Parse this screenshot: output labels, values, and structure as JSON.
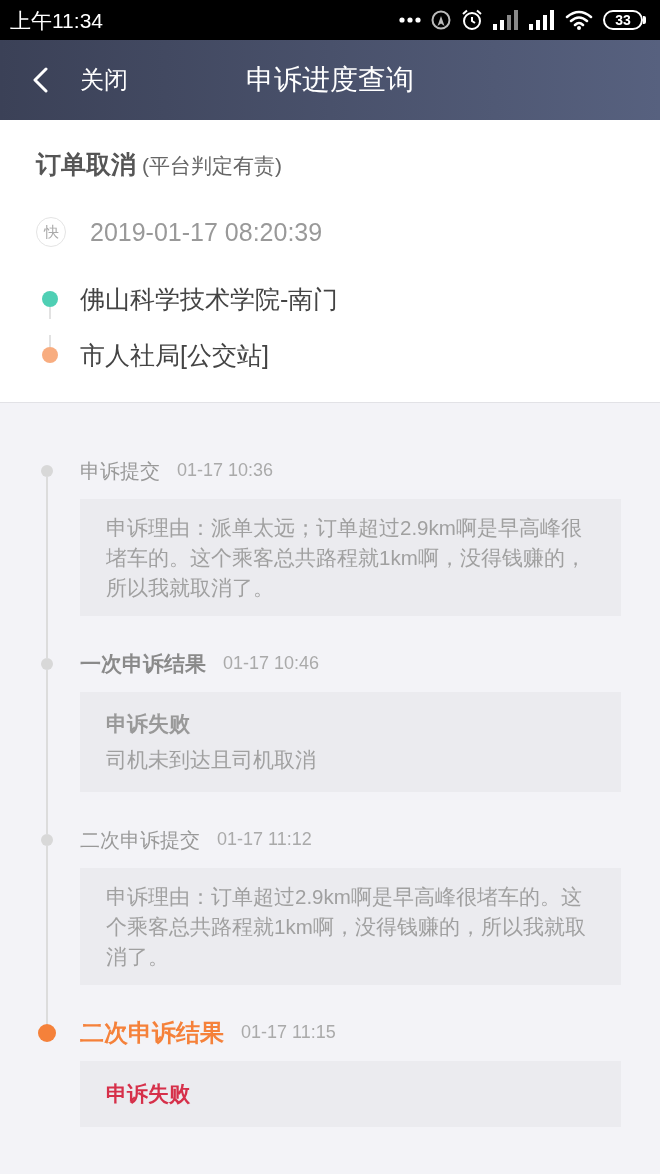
{
  "status_bar": {
    "time": "上午11:34",
    "battery": "33"
  },
  "nav_bar": {
    "back_label": "关闭",
    "title": "申诉进度查询"
  },
  "order": {
    "title": "订单取消",
    "verdict": "(平台判定有责)",
    "badge": "快",
    "time": "2019-01-17 08:20:39",
    "route": [
      {
        "place": "佛山科学技术学院-南门",
        "color": "#4fcfb4"
      },
      {
        "place": "市人社局[公交站]",
        "color": "#f8ad80"
      }
    ]
  },
  "timeline": [
    {
      "kind": "submission",
      "title": "申诉提交",
      "time": "01-17 10:36",
      "current": false,
      "text": "申诉理由：派单太远；订单超过2.9km啊是早高峰很堵车的。这个乘客总共路程就1km啊，没得钱赚的，所以我就取消了。"
    },
    {
      "kind": "result",
      "title": "一次申诉结果",
      "time": "01-17 10:46",
      "current": false,
      "outcome": "申诉失败",
      "detail": "司机未到达且司机取消"
    },
    {
      "kind": "submission",
      "title": "二次申诉提交",
      "time": "01-17 11:12",
      "current": false,
      "text": "申诉理由：订单超过2.9km啊是早高峰很堵车的。这个乘客总共路程就1km啊，没得钱赚的，所以我就取消了。"
    },
    {
      "kind": "result",
      "title": "二次申诉结果",
      "time": "01-17 11:15",
      "current": true,
      "outcome": "申诉失败"
    }
  ]
}
